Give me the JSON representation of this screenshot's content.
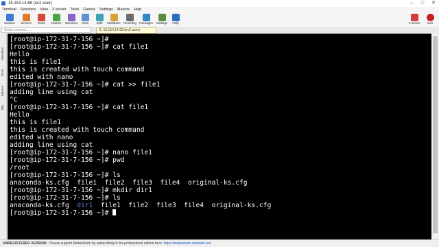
{
  "window": {
    "title": "15.154.14.68 (ec2-user)"
  },
  "menu": [
    "Terminal",
    "Sessions",
    "View",
    "X server",
    "Tools",
    "Games",
    "Settings",
    "Macros",
    "Help"
  ],
  "toolbar": {
    "items": [
      {
        "label": "Session",
        "color": "#3a7bd5"
      },
      {
        "label": "Servers",
        "color": "#e07b2a"
      },
      {
        "label": "Tools",
        "color": "#d24b3a"
      },
      {
        "label": "Games",
        "color": "#4aa547"
      },
      {
        "label": "Sessions",
        "color": "#8a64c7"
      },
      {
        "label": "View",
        "color": "#5b8fd6"
      },
      {
        "label": "Split",
        "color": "#3fa3b6"
      },
      {
        "label": "MultiExec",
        "color": "#d6a33a"
      },
      {
        "label": "Tunneling",
        "color": "#6b6b6b"
      },
      {
        "label": "Packages",
        "color": "#2f87c9"
      },
      {
        "label": "Settings",
        "color": "#5a8c3e"
      },
      {
        "label": "Help",
        "color": "#2b6cc4"
      }
    ],
    "xserver_label": "X server",
    "exit_label": "Exit"
  },
  "quick_connect": {
    "placeholder": "Quick connect..."
  },
  "session_tab": {
    "label": "5. 15.154.14.68 (ec2-user)"
  },
  "sidebar": {
    "items": [
      "Sessions",
      "Tools",
      "Macros",
      "Sftp"
    ]
  },
  "terminal": {
    "prompt": "[root@ip-172-31-7-156 ~]#",
    "lines": [
      "[root@ip-172-31-7-156 ~]#",
      "[root@ip-172-31-7-156 ~]# cat file1",
      "Hello",
      "this is file1",
      "this is created with touch command",
      "edited with nano",
      "[root@ip-172-31-7-156 ~]# cat >> file1",
      "adding line using cat",
      "^C",
      "[root@ip-172-31-7-156 ~]# cat file1",
      "Hello",
      "this is file1",
      "this is created with touch command",
      "edited with nano",
      "adding line using cat",
      "[root@ip-172-31-7-156 ~]# nano file1",
      "[root@ip-172-31-7-156 ~]# pwd",
      "/root",
      "[root@ip-172-31-7-156 ~]# ls",
      "anaconda-ks.cfg  file1  file2  file3  file4  original-ks.cfg",
      "[root@ip-172-31-7-156 ~]# mkdir dir1",
      "[root@ip-172-31-7-156 ~]# ls"
    ],
    "last_ls": {
      "before": "anaconda-ks.cfg  ",
      "dir": "dir1",
      "after": "  file1  file2  file3  file4  original-ks.cfg"
    }
  },
  "status": {
    "label": "UNREGISTERED VERSION",
    "message": " -  Please support MobaXterm by subscribing to the professional edition here: ",
    "link": "https://mobaxterm.mobatek.net"
  }
}
